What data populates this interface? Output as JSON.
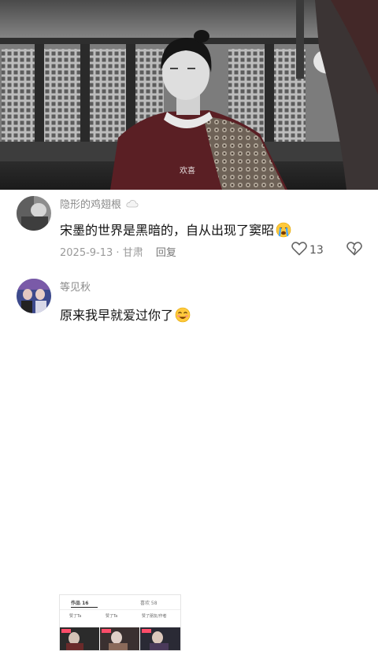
{
  "video": {
    "caption": "欢喜"
  },
  "comments": [
    {
      "username": "隐形的鸡翅根",
      "text": "宋墨的世界是黑暗的，自从出现了窦昭",
      "emoji": "crying-face-icon",
      "date": "2025-9-13",
      "location": "甘肃",
      "reply_label": "回复",
      "like_count": "13"
    },
    {
      "username": "等见秋",
      "text": "原来我早就爱过你了",
      "emoji": "smiling-face-icon",
      "embedded_screenshot": {
        "tab_works": "作品 16",
        "tab_liked": "喜欢 58",
        "labels": [
          "赞了Ta",
          "赞了Ta",
          "赞了朋友/作者"
        ]
      }
    }
  ],
  "colors": {
    "username": "#8a8a8a",
    "text": "#111111",
    "meta": "#9a9a9a"
  }
}
